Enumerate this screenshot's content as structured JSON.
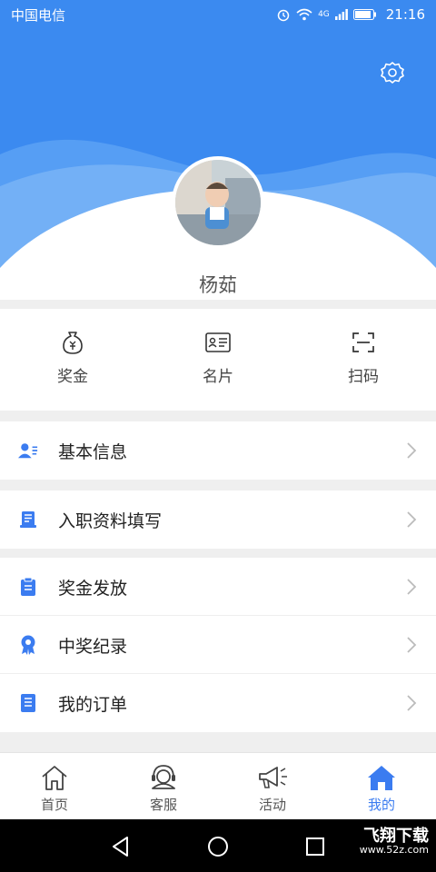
{
  "status_bar": {
    "carrier": "中国电信",
    "time": "21:16",
    "network": "4G"
  },
  "profile": {
    "name": "杨茹"
  },
  "quick_actions": [
    {
      "label": "奖金",
      "icon": "money-bag-icon"
    },
    {
      "label": "名片",
      "icon": "business-card-icon"
    },
    {
      "label": "扫码",
      "icon": "scan-icon"
    }
  ],
  "menu": [
    {
      "label": "基本信息",
      "icon": "user-info-icon"
    },
    {
      "label": "入职资料填写",
      "icon": "form-icon"
    },
    {
      "label": "奖金发放",
      "icon": "clipboard-icon"
    },
    {
      "label": "中奖纪录",
      "icon": "award-icon"
    },
    {
      "label": "我的订单",
      "icon": "order-icon"
    }
  ],
  "tabs": [
    {
      "label": "首页",
      "icon": "home-outline-icon",
      "active": false
    },
    {
      "label": "客服",
      "icon": "headset-icon",
      "active": false
    },
    {
      "label": "活动",
      "icon": "megaphone-icon",
      "active": false
    },
    {
      "label": "我的",
      "icon": "home-filled-icon",
      "active": true
    }
  ],
  "watermark": {
    "title": "飞翔下载",
    "url": "www.52z.com"
  },
  "colors": {
    "accent": "#3b7cf0",
    "header_blue": "#3b8af0"
  }
}
